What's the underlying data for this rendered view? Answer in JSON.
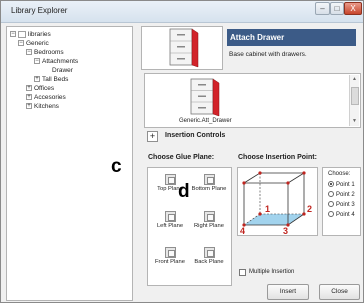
{
  "window": {
    "title": "Library Explorer",
    "controls": [
      "–",
      "□",
      "X"
    ]
  },
  "tree": {
    "items": [
      {
        "label": "libraries",
        "sign": "−"
      },
      {
        "label": "Generic",
        "sign": "−"
      },
      {
        "label": "Bedrooms",
        "sign": "−"
      },
      {
        "label": "Attachments",
        "sign": "−"
      },
      {
        "label": "Drawer",
        "sign": ""
      },
      {
        "label": "Tall Beds",
        "sign": "+"
      },
      {
        "label": "Offices",
        "sign": "+"
      },
      {
        "label": "Accesories",
        "sign": "+"
      },
      {
        "label": "Kitchens",
        "sign": "+"
      }
    ]
  },
  "annotations": {
    "c": "c",
    "d": "d"
  },
  "header": {
    "title": "Attach Drawer",
    "description": "Base cabinet with drawers."
  },
  "gallery": {
    "caption": "Generic.Att_Drawer"
  },
  "insertion_controls": {
    "toggle": "+",
    "label": "Insertion Controls"
  },
  "glue": {
    "title": "Choose Glue Plane:",
    "options": [
      "Top Plane",
      "Bottom Plane",
      "Left Plane",
      "Right Plane",
      "Front Plane",
      "Back Plane"
    ]
  },
  "insertion_point": {
    "title": "Choose Insertion Point:",
    "cube_labels": [
      "1",
      "2",
      "3",
      "4"
    ],
    "choose_label": "Choose:",
    "points": [
      "Point 1",
      "Point 2",
      "Point 3",
      "Point 4"
    ],
    "selected": "Point 1"
  },
  "multiple_insertion": {
    "label": "Multiple Insertion",
    "checked": false
  },
  "buttons": {
    "insert": "Insert",
    "close": "Close"
  },
  "colors": {
    "header_bg": "#3c5b87",
    "drawer_red": "#d2232a",
    "cube_blue": "#7bc1e6",
    "cube_label_red": "#c0251f"
  }
}
